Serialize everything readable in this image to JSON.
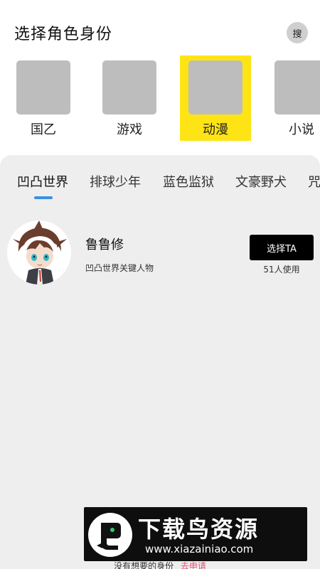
{
  "header": {
    "title": "选择角色身份",
    "search_label": "搜"
  },
  "categories": [
    {
      "label": "国乙",
      "active": false
    },
    {
      "label": "游戏",
      "active": false
    },
    {
      "label": "动漫",
      "active": true
    },
    {
      "label": "小说",
      "active": false
    }
  ],
  "tabs": [
    {
      "label": "凹凸世界",
      "active": true
    },
    {
      "label": "排球少年",
      "active": false
    },
    {
      "label": "蓝色监狱",
      "active": false
    },
    {
      "label": "文豪野犬",
      "active": false
    },
    {
      "label": "咒",
      "active": false
    }
  ],
  "characters": [
    {
      "name": "鲁鲁修",
      "description": "凹凸世界关键人物",
      "button_label": "选择TA",
      "usage": "51人使用"
    }
  ],
  "footer": {
    "text": "没有想要的身份",
    "link": "去申请"
  },
  "watermark": {
    "title": "下载鸟资源",
    "url": "www.xiazainiao.com"
  },
  "colors": {
    "active_category": "#ffe415",
    "tab_indicator": "#3b8fe0",
    "footer_link": "#e84d75",
    "panel_bg": "#eeeeee"
  }
}
